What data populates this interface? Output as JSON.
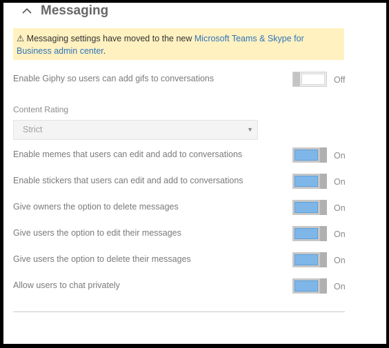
{
  "section": {
    "title": "Messaging"
  },
  "notice": {
    "text": "⚠ Messaging settings have moved to the new ",
    "link": "Microsoft Teams & Skype for Business admin center",
    "suffix": "."
  },
  "giphy": {
    "label": "Enable Giphy so users can add gifs to conversations",
    "state": "Off"
  },
  "content_rating": {
    "label": "Content Rating",
    "value": "Strict"
  },
  "settings": [
    {
      "label": "Enable memes that users can edit and add to conversations",
      "state": "On"
    },
    {
      "label": "Enable stickers that users can edit and add to conversations",
      "state": "On"
    },
    {
      "label": "Give owners the option to delete messages",
      "state": "On"
    },
    {
      "label": "Give users the option to edit their messages",
      "state": "On"
    },
    {
      "label": "Give users the option to delete their messages",
      "state": "On"
    },
    {
      "label": "Allow users to chat privately",
      "state": "On"
    }
  ],
  "colors": {
    "notice_bg": "#fff1c0",
    "link": "#2f74b9",
    "toggle_on": "#7fb6e8"
  }
}
